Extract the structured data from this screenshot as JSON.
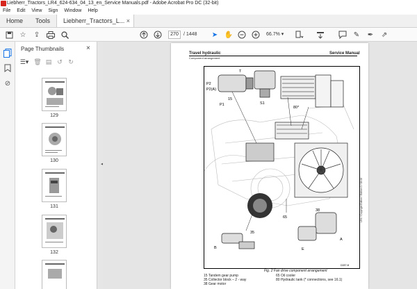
{
  "window": {
    "title": "Liebherr_Tractors_LR4_624-634_04_13_en_Service Manuals.pdf - Adobe Acrobat Pro DC (32-bit)"
  },
  "menu": [
    "File",
    "Edit",
    "View",
    "Sign",
    "Window",
    "Help"
  ],
  "tabs": {
    "home": "Home",
    "tools": "Tools",
    "document": "Liebherr_Tractors_L...",
    "close": "×"
  },
  "toolbar": {
    "page_current": "270",
    "page_total": "/ 1448",
    "zoom": "66.7%"
  },
  "panel": {
    "title": "Page Thumbnails",
    "close": "×",
    "thumbnails": [
      {
        "label": "129"
      },
      {
        "label": "130"
      },
      {
        "label": "131"
      },
      {
        "label": "132"
      }
    ]
  },
  "page": {
    "header_left": "Travel hydraulic",
    "header_right": "Service Manual",
    "subheader": "Component arrangement",
    "caption": "Fig. 2     Fan drive component arrangement",
    "legend": [
      [
        "15    Tandem gear pump",
        "65    Oil cooler"
      ],
      [
        "35    Collector block – 2 - way",
        "80    Hydraulic tank (* connections, see 16.1)"
      ],
      [
        "38    Gear motor",
        ""
      ]
    ],
    "side_print": "LR4 / Copyright Edition / Edition 0 / 08.08",
    "fig_labels": {
      "p2": "P2",
      "p2a": "P2(A)",
      "p1": "P1",
      "n15": "15",
      "n80": "80*",
      "s1": "S1",
      "n65": "65",
      "n38": "38",
      "n35": "35",
      "b": "B",
      "a": "A",
      "e": "E",
      "t": "T",
      "figno": "D287 M"
    }
  },
  "colors": {
    "acrobat_red": "#d7261e",
    "accent_blue": "#1473e6"
  }
}
